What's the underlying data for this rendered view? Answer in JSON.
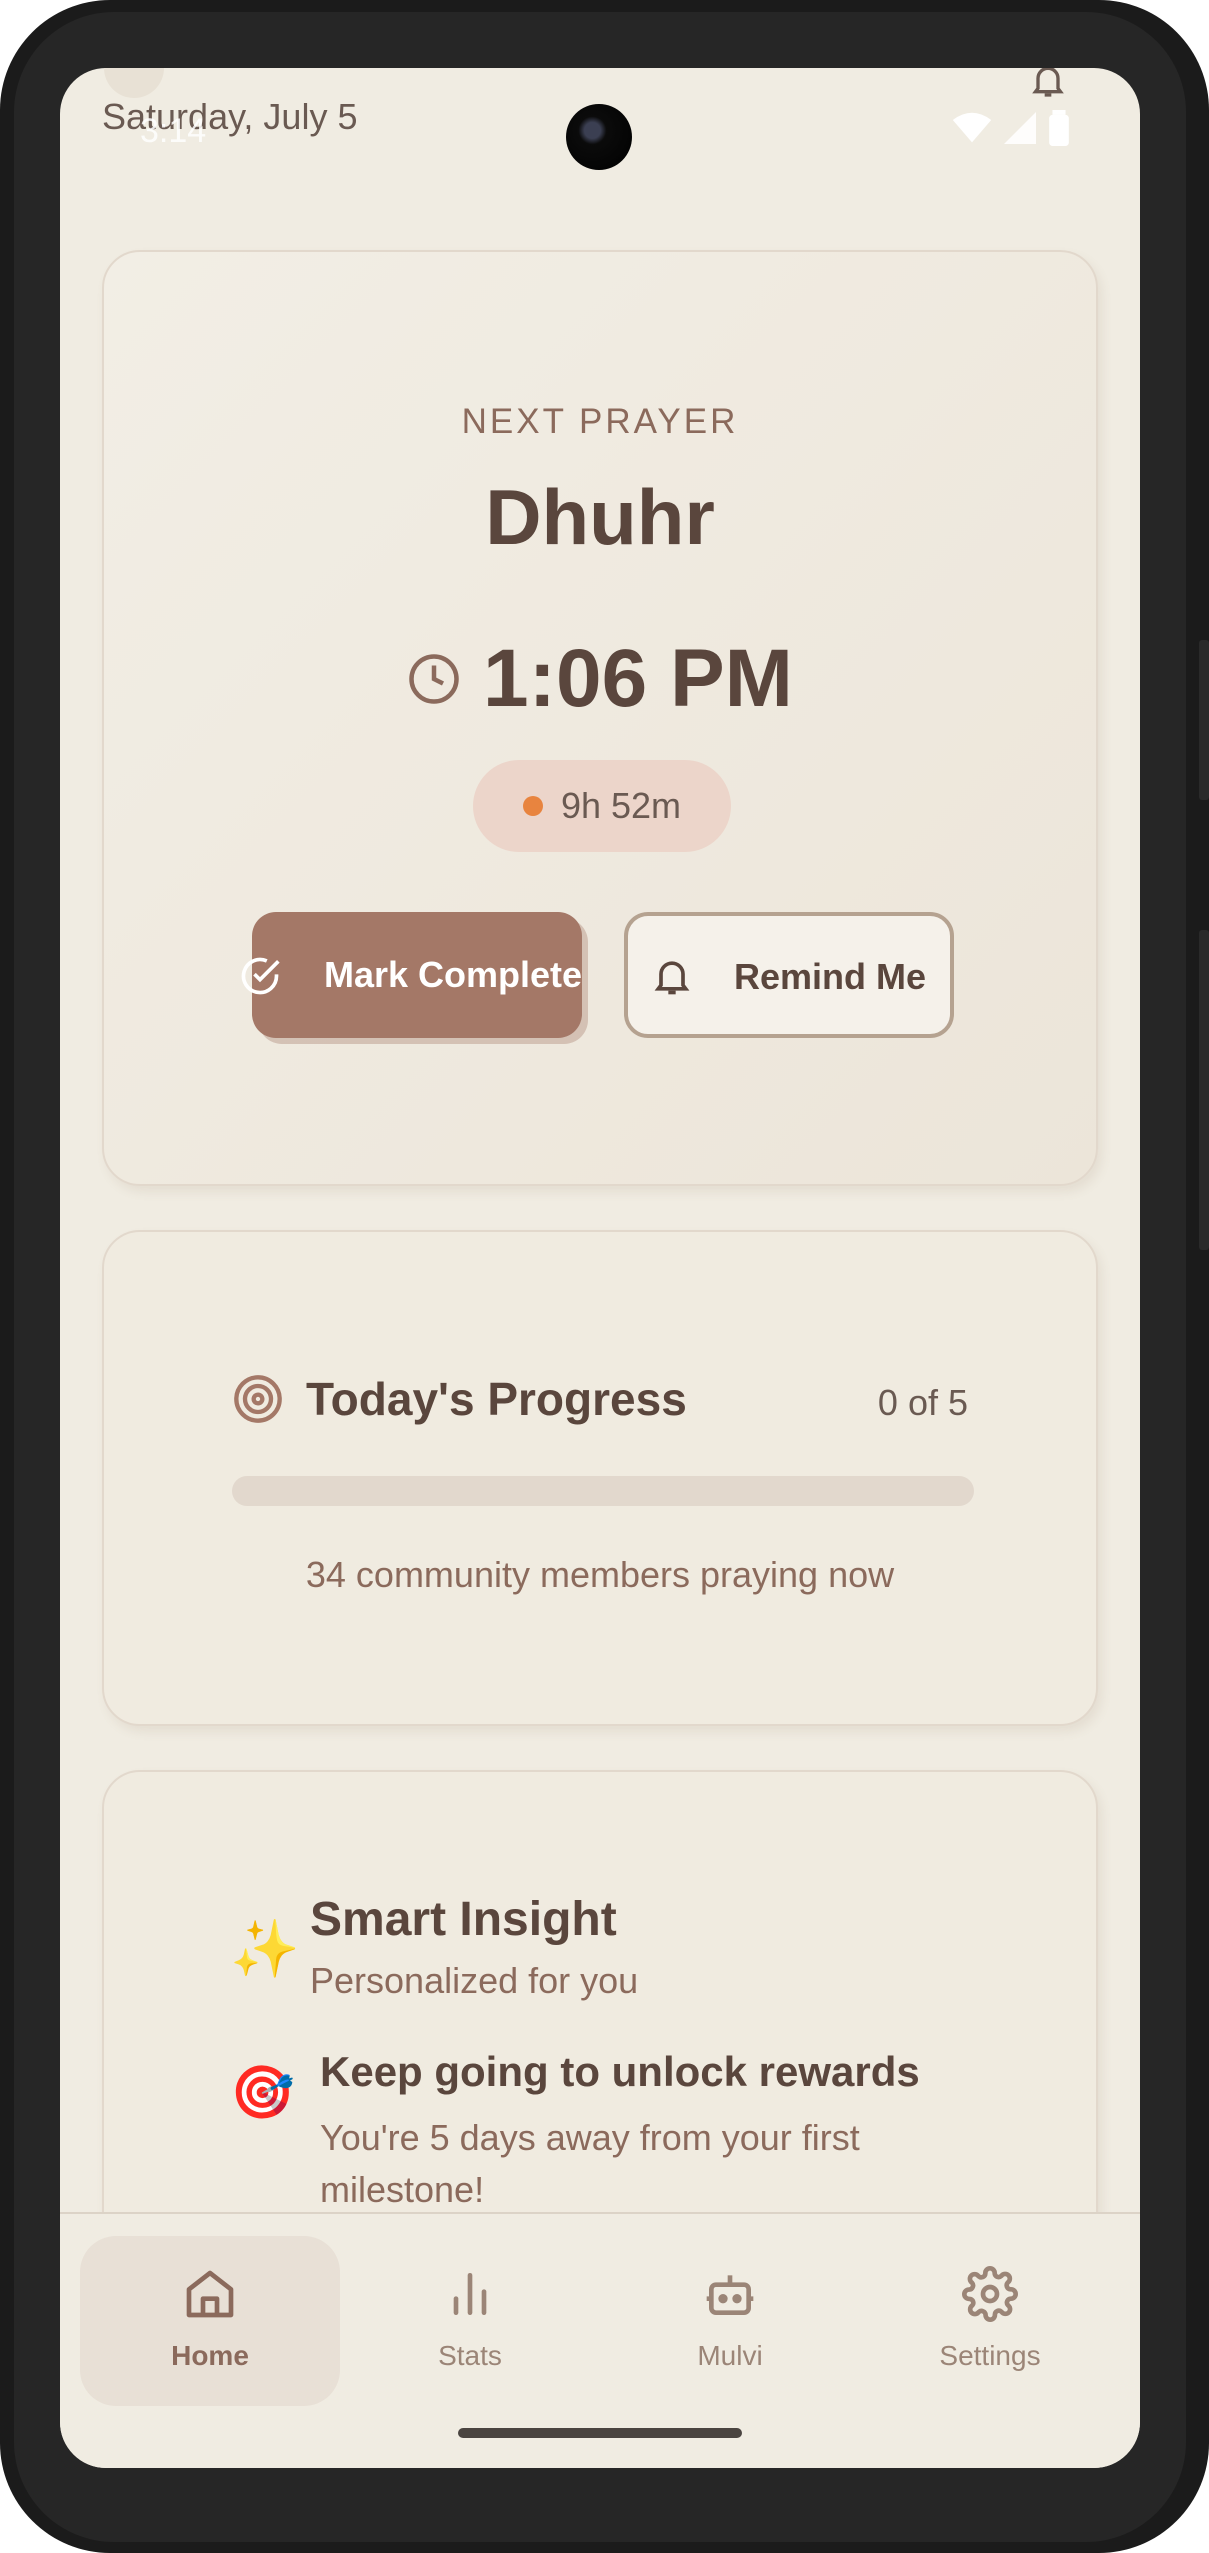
{
  "status_bar": {
    "date": "Saturday, July 5",
    "time": "3:14"
  },
  "prayer_card": {
    "eyebrow": "NEXT PRAYER",
    "prayer_name": "Dhuhr",
    "prayer_time": "1:06 PM",
    "countdown": "9h 52m",
    "mark_complete_label": "Mark Complete",
    "remind_me_label": "Remind Me"
  },
  "progress_card": {
    "title": "Today's Progress",
    "count_label": "0 of 5",
    "completed": 0,
    "total": 5,
    "community_text": "34 community members praying now"
  },
  "insight_card": {
    "title": "Smart Insight",
    "subtitle": "Personalized for you",
    "tip_title": "Keep going to unlock rewards",
    "tip_body": "You're 5 days away from your first milestone!"
  },
  "nav": {
    "items": [
      {
        "label": "Home",
        "icon": "home-icon",
        "active": true
      },
      {
        "label": "Stats",
        "icon": "stats-icon",
        "active": false
      },
      {
        "label": "Mulvi",
        "icon": "robot-icon",
        "active": false
      },
      {
        "label": "Settings",
        "icon": "gear-icon",
        "active": false
      }
    ]
  },
  "colors": {
    "background": "#f0ece2",
    "accent": "#a47867",
    "text_primary": "#5a463d",
    "text_secondary": "#8b6a5c",
    "countdown_dot": "#e8843f"
  }
}
